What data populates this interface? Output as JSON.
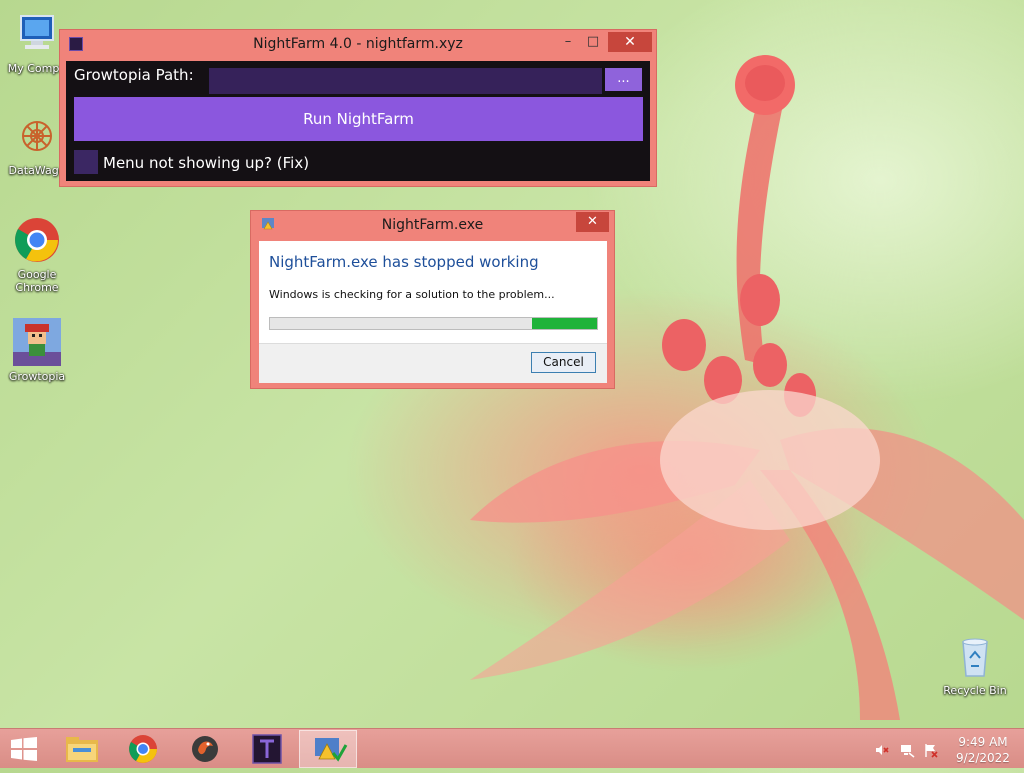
{
  "desktop": {
    "icons": [
      {
        "label": "My Compu",
        "icon": "computer-icon"
      },
      {
        "label": "DataWago",
        "icon": "datawagon-icon"
      },
      {
        "label": "Google Chrome",
        "icon": "chrome-icon"
      },
      {
        "label": "Growtopia",
        "icon": "growtopia-icon"
      },
      {
        "label": "Recycle Bin",
        "icon": "recycle-bin-icon"
      }
    ]
  },
  "nightfarm_window": {
    "title": "NightFarm 4.0 - nightfarm.xyz",
    "minimize_glyph": "–",
    "maximize_glyph": "□",
    "close_glyph": "✕",
    "path_label": "Growtopia Path:",
    "path_value": "",
    "browse_label": "...",
    "run_label": "Run NightFarm",
    "fix_label": "Menu not showing up? (Fix)"
  },
  "error_dialog": {
    "title": "NightFarm.exe",
    "close_glyph": "✕",
    "heading": "NightFarm.exe has stopped working",
    "message": "Windows is checking for a solution to the problem...",
    "progress": {
      "start": 0.8,
      "end": 1.0
    },
    "cancel_label": "Cancel"
  },
  "taskbar": {
    "pinned": [
      {
        "name": "file-explorer",
        "icon": "folder-icon",
        "active": false
      },
      {
        "name": "chrome",
        "icon": "chrome-icon",
        "active": false
      },
      {
        "name": "app-bird",
        "icon": "bird-app-icon",
        "active": false
      },
      {
        "name": "nightfarm",
        "icon": "nightfarm-app-icon",
        "active": false
      },
      {
        "name": "error-reporting",
        "icon": "error-report-icon",
        "active": true
      }
    ],
    "time": "9:49 AM",
    "date": "9/2/2022"
  },
  "colors": {
    "window_frame": "#f0837a",
    "accent_purple": "#8b57de",
    "progress_green": "#1fb33a",
    "error_heading": "#1e4f9a"
  }
}
